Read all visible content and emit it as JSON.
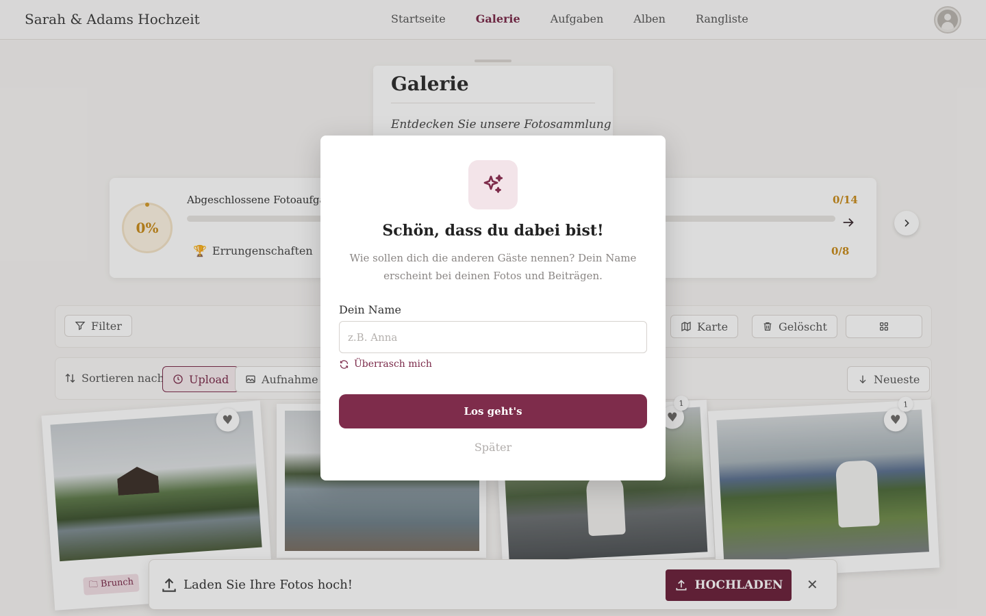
{
  "header": {
    "brand": "Sarah & Adams Hochzeit",
    "nav": [
      "Startseite",
      "Galerie",
      "Aufgaben",
      "Alben",
      "Rangliste"
    ],
    "active_nav": "Galerie"
  },
  "gallery": {
    "title": "Galerie",
    "subtitle": "Entdecken Sie unsere Fotosammlung"
  },
  "progress": {
    "percent_label": "0%",
    "percent": 0,
    "tasks_label": "Abgeschlossene Fotoaufgaben",
    "tasks_count": "0/14",
    "achievements_label": "Errungenschaften",
    "achievements_count": "0/8"
  },
  "filters": {
    "filter_label": "Filter",
    "map_label": "Karte",
    "deleted_label": "Gelöscht"
  },
  "sort": {
    "label": "Sortieren nach",
    "options": [
      "Upload",
      "Aufnahme"
    ],
    "selected": "Upload",
    "order_label": "Neueste"
  },
  "photos": [
    {
      "tag": "Brunch",
      "likes": ""
    },
    {
      "tag": "",
      "likes": ""
    },
    {
      "tag": "",
      "likes": "1"
    },
    {
      "tag": "",
      "likes": "1"
    }
  ],
  "toast": {
    "text": "Laden Sie Ihre Fotos hoch!",
    "button": "HOCHLADEN"
  },
  "modal": {
    "title": "Schön, dass du dabei bist!",
    "description": "Wie sollen dich die anderen Gäste nennen? Dein Name erscheint bei deinen Fotos und Beiträgen.",
    "name_label": "Dein Name",
    "name_placeholder": "z.B. Anna",
    "name_value": "",
    "surprise_label": "Überrasch mich",
    "primary_button": "Los geht's",
    "later_label": "Später"
  },
  "colors": {
    "accent": "#7e2c4b",
    "accent_dark": "#6a1f3a",
    "gold": "#c98b18"
  }
}
